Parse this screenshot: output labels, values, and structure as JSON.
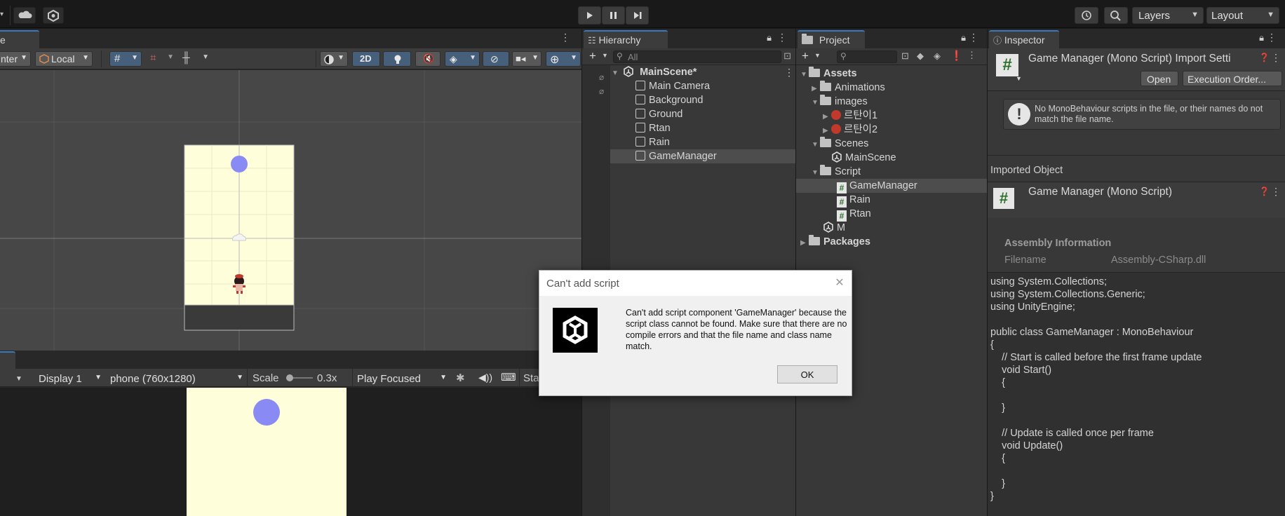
{
  "toolbar": {
    "layers_label": "Layers",
    "layout_label": "Layout"
  },
  "scene": {
    "tab_label": "e",
    "pivot_label": "nter",
    "space_label": "Local",
    "mode_2d": "2D"
  },
  "game": {
    "display_label": "Display 1",
    "resolution_label": "phone (760x1280)",
    "scale_label": "Scale",
    "scale_value": "0.3x",
    "play_mode_label": "Play Focused",
    "stats_label": "Sta"
  },
  "hierarchy": {
    "tab_label": "Hierarchy",
    "search_placeholder": "All",
    "scene_name": "MainScene*",
    "items": [
      "Main Camera",
      "Background",
      "Ground",
      "Rtan",
      "Rain",
      "GameManager"
    ]
  },
  "project": {
    "tab_label": "Project",
    "assets_label": "Assets",
    "animations_label": "Animations",
    "images_label": "images",
    "image_items": [
      "르탄이1",
      "르탄이2"
    ],
    "scenes_label": "Scenes",
    "mainscene_label": "MainScene",
    "script_label": "Script",
    "script_items": [
      "GameManager",
      "Rain",
      "Rtan"
    ],
    "m_label": "M",
    "packages_label": "Packages"
  },
  "inspector": {
    "tab_label": "Inspector",
    "header_title": "Game Manager (Mono Script) Import Setti",
    "open_label": "Open",
    "execution_order_label": "Execution Order...",
    "warning_text": "No MonoBehaviour scripts in the file, or their names do not match the file name.",
    "imported_object_label": "Imported Object",
    "object_title": "Game Manager (Mono Script)",
    "assembly_info_label": "Assembly Information",
    "filename_label": "Filename",
    "filename_value": "Assembly-CSharp.dll",
    "code_lines": [
      "using System.Collections;",
      "using System.Collections.Generic;",
      "using UnityEngine;",
      "",
      "public class GameManager : MonoBehaviour",
      "{",
      "    // Start is called before the first frame update",
      "    void Start()",
      "    {",
      "",
      "    }",
      "",
      "    // Update is called once per frame",
      "    void Update()",
      "    {",
      "",
      "    }",
      "}"
    ]
  },
  "dialog": {
    "title": "Can't add script",
    "message": "Can't add script component 'GameManager' because the script class cannot be found. Make sure that there are no compile errors and that the file name and class name match.",
    "ok_label": "OK"
  },
  "colors": {
    "accent": "#3a79bb",
    "panel_bg": "#383838",
    "dark_bg": "#191919",
    "scene_bg": "#474747",
    "game_bg": "#fffedb",
    "circle": "#8a8af5"
  }
}
